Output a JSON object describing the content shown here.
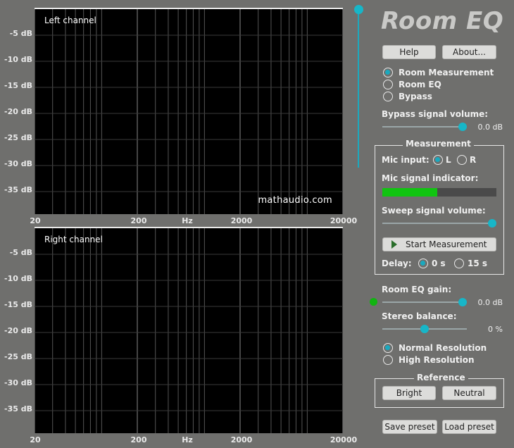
{
  "app_title": "Room EQ",
  "plots": {
    "left": {
      "title": "Left channel",
      "watermark": "mathaudio.com"
    },
    "right": {
      "title": "Right channel"
    },
    "y_labels": [
      "-5 dB",
      "-10 dB",
      "-15 dB",
      "-20 dB",
      "-25 dB",
      "-30 dB",
      "-35 dB"
    ],
    "x_labels": {
      "f20": "20",
      "f200": "200",
      "unit": "Hz",
      "f2000": "2000",
      "f20000": "20000"
    }
  },
  "buttons": {
    "help": "Help",
    "about": "About...",
    "start_measurement": "Start Measurement",
    "bright": "Bright",
    "neutral": "Neutral",
    "save_preset": "Save preset",
    "load_preset": "Load preset"
  },
  "mode": {
    "options": [
      "Room Measurement",
      "Room EQ",
      "Bypass"
    ],
    "selected": "Room Measurement"
  },
  "bypass_volume": {
    "label": "Bypass signal volume:",
    "value_text": "0.0 dB",
    "level": 0.9
  },
  "measurement": {
    "legend": "Measurement",
    "mic_input_label": "Mic input:",
    "mic_options": [
      "L",
      "R"
    ],
    "mic_selected": "L",
    "mic_indicator_label": "Mic signal indicator:",
    "mic_level": 0.48,
    "sweep_label": "Sweep signal volume:",
    "sweep_level": 1.0,
    "delay_label": "Delay:",
    "delay_options": [
      "0 s",
      "15 s"
    ],
    "delay_selected": "0 s"
  },
  "eq_gain": {
    "label": "Room EQ gain:",
    "value_text": "0.0 dB",
    "level": 0.9
  },
  "stereo_balance": {
    "label": "Stereo balance:",
    "value_text": "0 %",
    "level": 0.5
  },
  "resolution": {
    "options": [
      "Normal Resolution",
      "High Resolution"
    ],
    "selected": "Normal Resolution"
  },
  "reference": {
    "legend": "Reference"
  },
  "colors": {
    "accent": "#17b6c8",
    "meter": "#11c411",
    "indicator_dot": "#11b411"
  }
}
